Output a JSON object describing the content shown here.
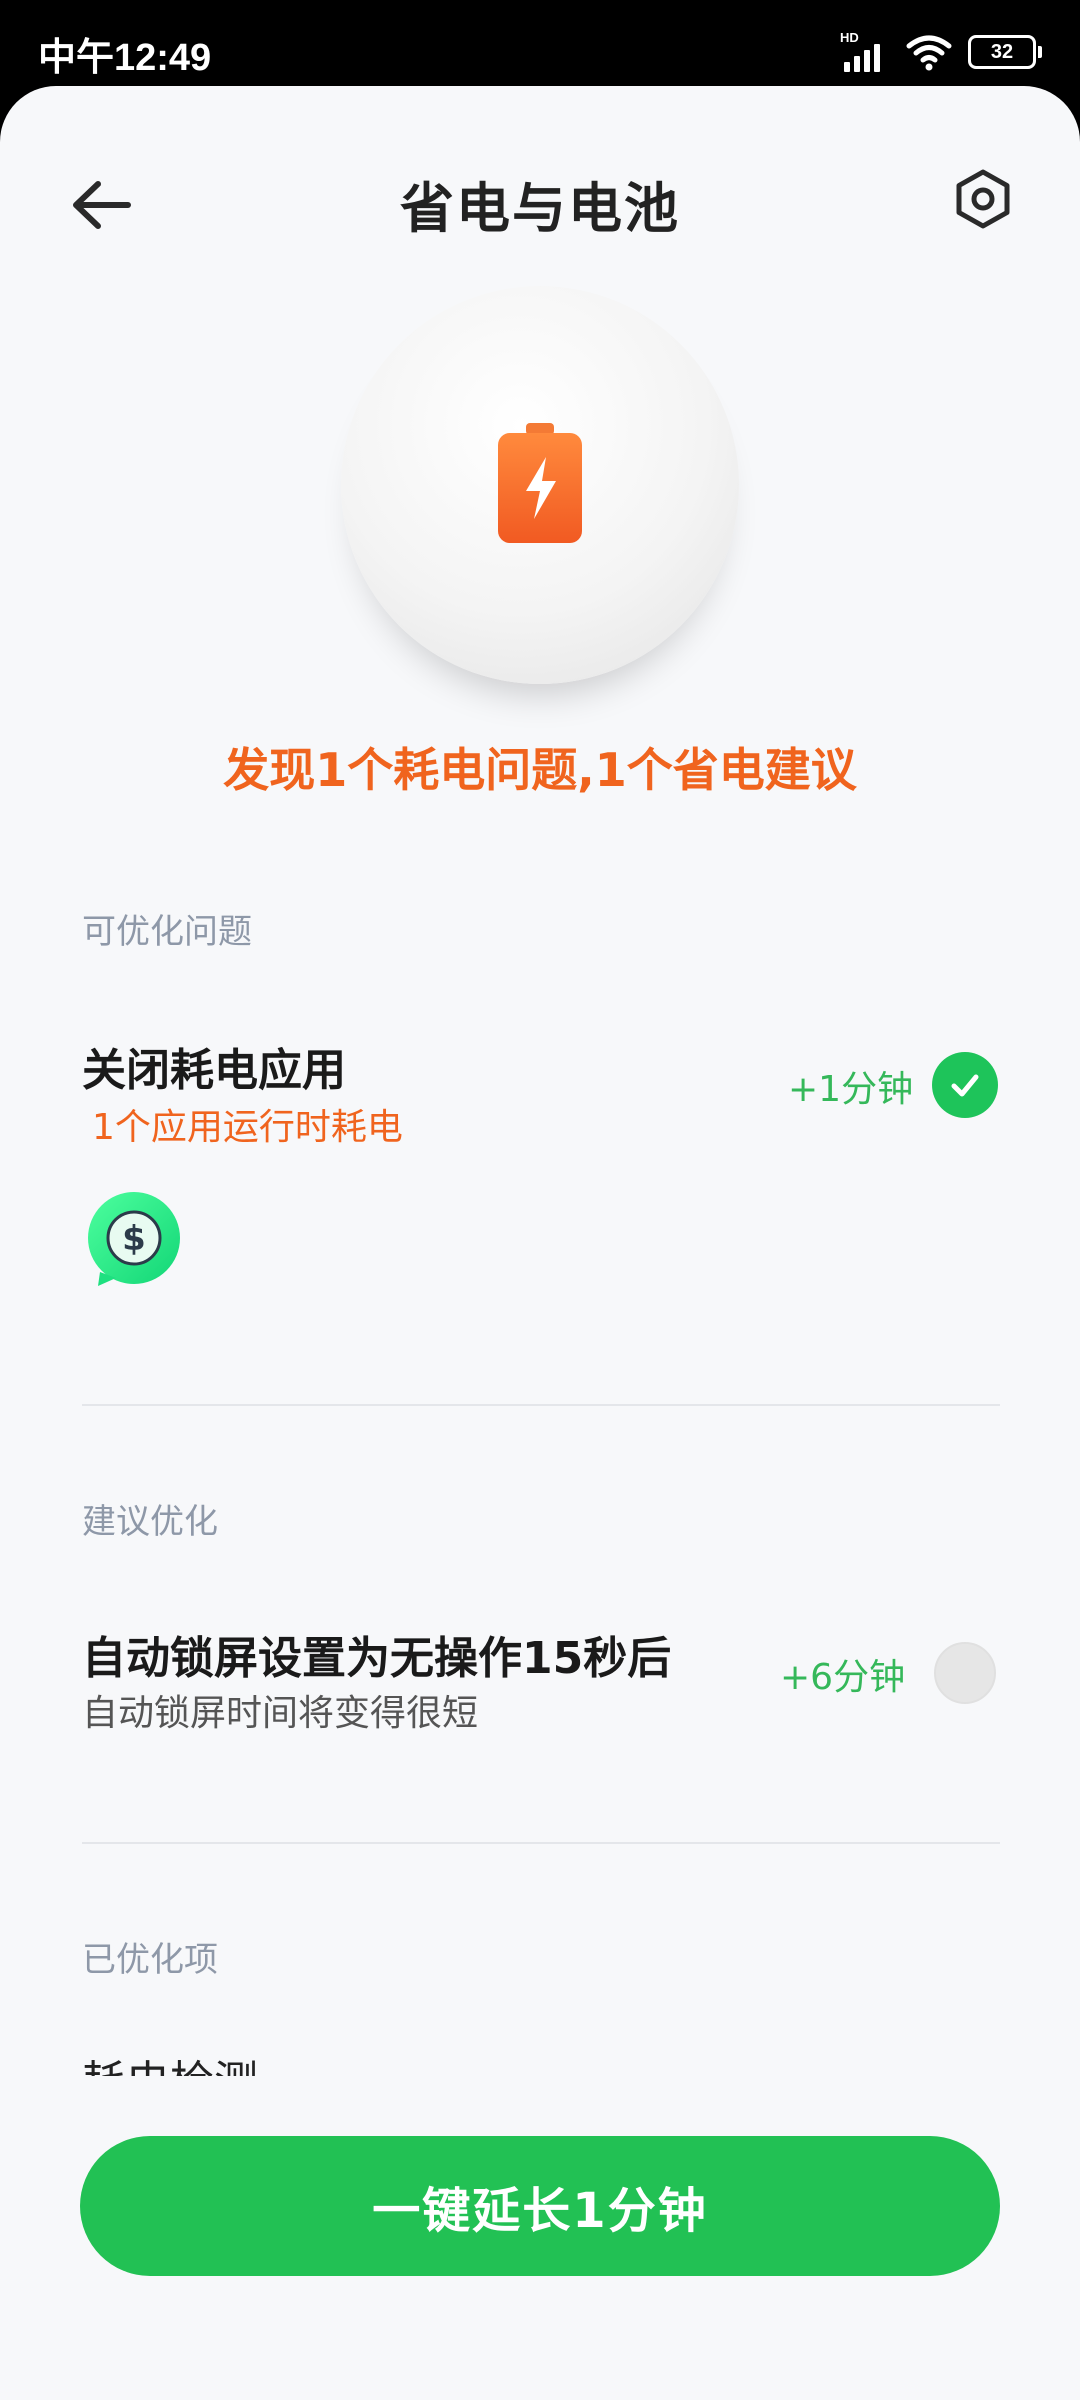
{
  "status_bar": {
    "time": "中午12:49",
    "network_badge": "HD",
    "battery_level": "32",
    "icons": [
      "signal-icon",
      "wifi-icon",
      "battery-icon"
    ]
  },
  "header": {
    "title": "省电与电池",
    "back_icon": "back-arrow-icon",
    "settings_icon": "settings-icon"
  },
  "hero": {
    "icon": "battery-charging-icon",
    "headline": "发现1个耗电问题,1个省电建议"
  },
  "sections": {
    "issues": {
      "label": "可优化问题",
      "item": {
        "title": "关闭耗电应用",
        "subtitle": "1个应用运行时耗电",
        "gain": "+1分钟",
        "checked": true,
        "app_icon": "app-icon"
      }
    },
    "suggestions": {
      "label": "建议优化",
      "item": {
        "title": "自动锁屏设置为无操作15秒后",
        "subtitle": "自动锁屏时间将变得很短",
        "gain": "+6分钟",
        "checked": false
      }
    },
    "optimized": {
      "label": "已优化项",
      "partial_item_text": "耗电检测"
    }
  },
  "action_button": {
    "label": "一键延长1分钟"
  },
  "colors": {
    "accent_orange": "#f0641e",
    "accent_green": "#22c154",
    "gain_green": "#35b85a",
    "section_label": "#8e98a8",
    "background": "#f7f8fa"
  }
}
